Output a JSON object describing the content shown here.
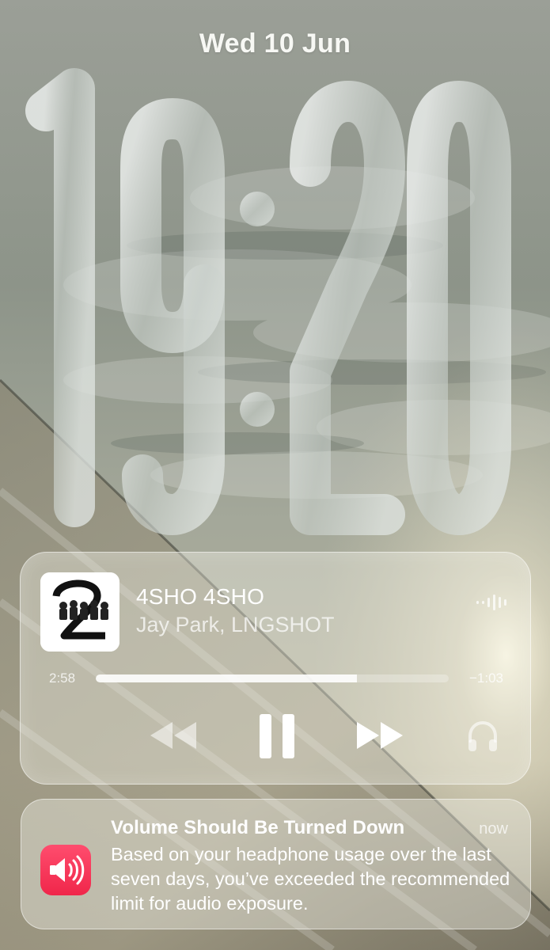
{
  "lockscreen": {
    "date": "Wed 10 Jun",
    "time": "19:20",
    "time_hours": "19",
    "time_minutes": "20"
  },
  "now_playing": {
    "title": "4SHO 4SHO",
    "artist": "Jay Park, LNGSHOT",
    "elapsed": "2:58",
    "remaining": "−1:03",
    "progress": 0.74,
    "artwork_icon": "album-art",
    "controls": [
      "rewind-icon",
      "pause-icon",
      "fast-forward-icon",
      "headphones-icon",
      "waveform-icon"
    ]
  },
  "notification": {
    "title": "Volume Should Be Turned Down",
    "time": "now",
    "body": "Based on your headphone usage over the last seven days, you’ve exceeded the recommended limit for audio exposure.",
    "icon": "speaker-volume-icon",
    "icon_color": "#f0264a"
  },
  "colors": {
    "accent_red": "#f0264a",
    "text_white": "#ffffff"
  }
}
